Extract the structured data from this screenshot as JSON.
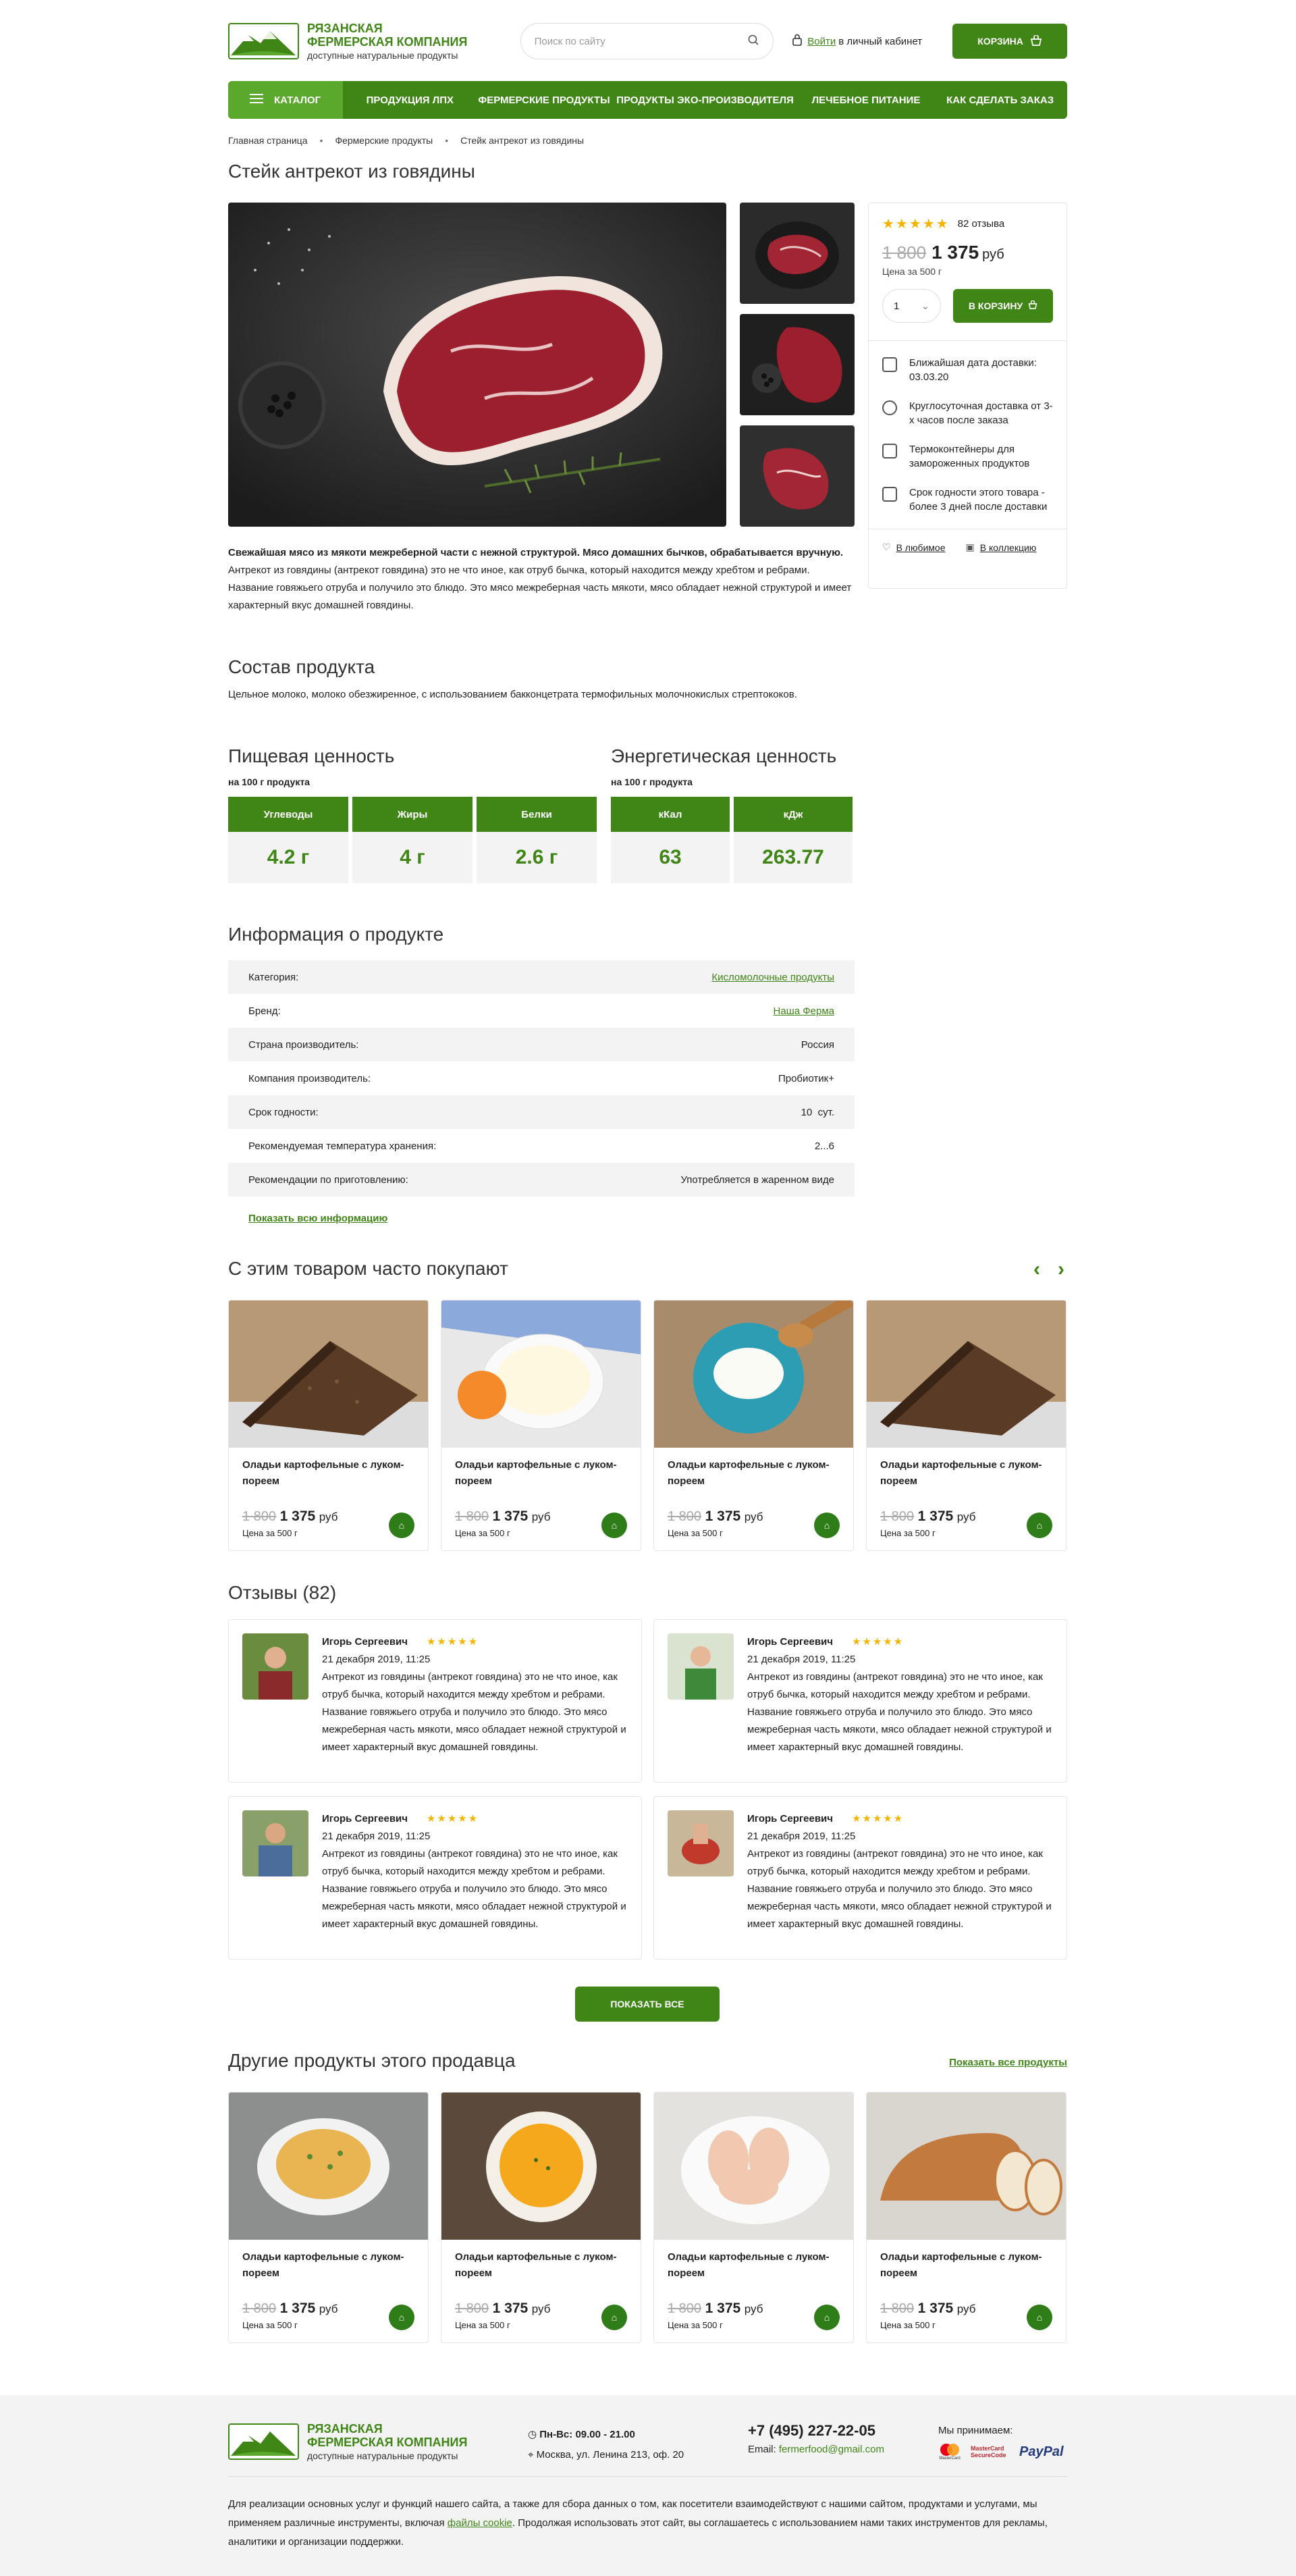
{
  "header": {
    "logo_line1": "Рязанская",
    "logo_line2": "Фермерская компания",
    "logo_tagline": "доступные натуральные продукты",
    "search_placeholder": "Поиск по сайту",
    "login_link": "Войти",
    "login_rest": "в личный кабинет",
    "cart_label": "Корзина"
  },
  "nav": {
    "catalog": "Каталог",
    "items": [
      "Продукция ЛПХ",
      "Фермерские продукты",
      "Продукты эко-производителя",
      "Лечебное питание",
      "Как сделать заказ"
    ]
  },
  "breadcrumbs": [
    "Главная страница",
    "Фермерские продукты",
    "Стейк антрекот из говядины"
  ],
  "product": {
    "title": "Стейк антрекот из говядины",
    "rating_stars": "★★★★★",
    "reviews_count": "82 отзыва",
    "price_old": "1 800",
    "price_new": "1 375",
    "currency": "руб",
    "unit": "Цена за 500 г",
    "qty": "1",
    "to_cart": "В корзину",
    "features": [
      {
        "icon": "truck-icon",
        "text": "Ближайшая дата доставки: 03.03.20"
      },
      {
        "icon": "clock-icon",
        "text": "Круглосуточная доставка от 3-х часов после заказа"
      },
      {
        "icon": "thermo-container-icon",
        "text": "Термоконтейнеры для замороженных продуктов"
      },
      {
        "icon": "calendar-icon",
        "text": "Срок годности этого товара - более 3 дней после доставки"
      }
    ],
    "favorite": "В любимое",
    "collection": "В коллекцию",
    "lead": "Свежайшая мясо из мякоти межреберной части с нежной структурой. Мясо домашних бычков, обрабатывается вручную.",
    "description": "Антрекот из говядины (антрекот говядина) это не что иное, как отруб бычка, который находится между хребтом и ребрами. Название говяжьего отруба и получило это блюдо. Это мясо межреберная часть мякоти, мясо обладает нежной структурой и имеет характерный вкус домашней говядины."
  },
  "composition": {
    "title": "Состав продукта",
    "text": "Цельное молоко, молоко обезжиренное, с использованием бакконцетрата термофильных молочнокислых стрептококов."
  },
  "nutrition": {
    "title": "Пищевая ценность",
    "per": "на 100 г продукта",
    "headers": [
      "Углеводы",
      "Жиры",
      "Белки"
    ],
    "values": [
      "4.2 г",
      "4 г",
      "2.6 г"
    ]
  },
  "energy": {
    "title": "Энергетическая ценность",
    "per": "на 100 г продукта",
    "headers": [
      "кКал",
      "кДж"
    ],
    "values": [
      "63",
      "263.77"
    ]
  },
  "info": {
    "title": "Информация о продукте",
    "rows": [
      {
        "label": "Категория:",
        "value": "Кисломолочные продукты"
      },
      {
        "label": "Бренд:",
        "value": "Наша Ферма"
      },
      {
        "label": "Страна производитель:",
        "value": "Россия"
      },
      {
        "label": "Компания производитель:",
        "value": "Пробиотик+"
      },
      {
        "label": "Срок годности:",
        "value": "10  сут."
      },
      {
        "label": "Рекомендуемая температура хранения:",
        "value": "2...6"
      },
      {
        "label": "Рекомендации по приготовлению:",
        "value": "Употребляется в жаренном виде"
      }
    ],
    "show_all": "Показать всю информацию"
  },
  "related": {
    "title": "С этим товаром часто покупают",
    "cards": [
      {
        "name": "Оладьи картофельные с луком-пореем",
        "old": "1 800",
        "new": "1 375",
        "cur": "руб",
        "unit": "Цена за 500 г"
      },
      {
        "name": "Оладьи картофельные с луком-пореем",
        "old": "1 800",
        "new": "1 375",
        "cur": "руб",
        "unit": "Цена за 500 г"
      },
      {
        "name": "Оладьи картофельные с луком-пореем",
        "old": "1 800",
        "new": "1 375",
        "cur": "руб",
        "unit": "Цена за 500 г"
      },
      {
        "name": "Оладьи картофельные с луком-пореем",
        "old": "1 800",
        "new": "1 375",
        "cur": "руб",
        "unit": "Цена за 500 г"
      }
    ]
  },
  "reviews": {
    "title": "Отзывы (82)",
    "items": [
      {
        "name": "Игорь Сергеевич",
        "stars": "★★★★★",
        "date": "21 декабря 2019, 11:25",
        "text": "Антрекот из говядины (антрекот говядина) это не что иное, как отруб бычка, который находится между хребтом и ребрами. Название говяжьего отруба и получило это блюдо. Это мясо межреберная часть мякоти, мясо обладает нежной структурой и имеет характерный вкус домашней говядины."
      },
      {
        "name": "Игорь Сергеевич",
        "stars": "★★★★★",
        "date": "21 декабря 2019, 11:25",
        "text": "Антрекот из говядины (антрекот говядина) это не что иное, как отруб бычка, который находится между хребтом и ребрами. Название говяжьего отруба и получило это блюдо. Это мясо межреберная часть мякоти, мясо обладает нежной структурой и имеет характерный вкус домашней говядины."
      },
      {
        "name": "Игорь Сергеевич",
        "stars": "★★★★★",
        "date": "21 декабря 2019, 11:25",
        "text": "Антрекот из говядины (антрекот говядина) это не что иное, как отруб бычка, который находится между хребтом и ребрами. Название говяжьего отруба и получило это блюдо. Это мясо межреберная часть мякоти, мясо обладает нежной структурой и имеет характерный вкус домашней говядины."
      },
      {
        "name": "Игорь Сергеевич",
        "stars": "★★★★★",
        "date": "21 декабря 2019, 11:25",
        "text": "Антрекот из говядины (антрекот говядина) это не что иное, как отруб бычка, который находится между хребтом и ребрами. Название говяжьего отруба и получило это блюдо. Это мясо межреберная часть мякоти, мясо обладает нежной структурой и имеет характерный вкус домашней говядины."
      }
    ],
    "show_all": "Показать все"
  },
  "seller": {
    "title": "Другие продукты этого продавца",
    "show_all": "Показать все продукты",
    "cards": [
      {
        "name": "Оладьи картофельные с луком-пореем",
        "old": "1 800",
        "new": "1 375",
        "cur": "руб",
        "unit": "Цена за 500 г"
      },
      {
        "name": "Оладьи картофельные с луком-пореем",
        "old": "1 800",
        "new": "1 375",
        "cur": "руб",
        "unit": "Цена за 500 г"
      },
      {
        "name": "Оладьи картофельные с луком-пореем",
        "old": "1 800",
        "new": "1 375",
        "cur": "руб",
        "unit": "Цена за 500 г"
      },
      {
        "name": "Оладьи картофельные с луком-пореем",
        "old": "1 800",
        "new": "1 375",
        "cur": "руб",
        "unit": "Цена за 500 г"
      }
    ]
  },
  "footer": {
    "hours": "Пн-Вс: 09.00 - 21.00",
    "address": "Москва, ул. Ленина 213, оф. 20",
    "phone": "+7 (495) 227-22-05",
    "email_label": "Email:",
    "email": "fermerfood@gmail.com",
    "payments_title": "Мы принимаем:",
    "payments": [
      "MasterCard",
      "MasterCard SecureCode",
      "PayPal"
    ],
    "cookie_text_1": "Для реализации основных услуг и функций нашего сайта, а также для сбора данных о том, как посетители взаимодействуют с нашими сайтом, продуктами и услугами, мы применяем различные инструменты, включая",
    "cookie_link": "файлы cookie",
    "cookie_text_2": ". Продолжая использовать этот сайт, вы соглашаетесь с использованием нами таких инструментов для рекламы, аналитики и организации поддержки."
  },
  "colors": {
    "brand_green": "#3f8616",
    "star": "#f5b400"
  }
}
